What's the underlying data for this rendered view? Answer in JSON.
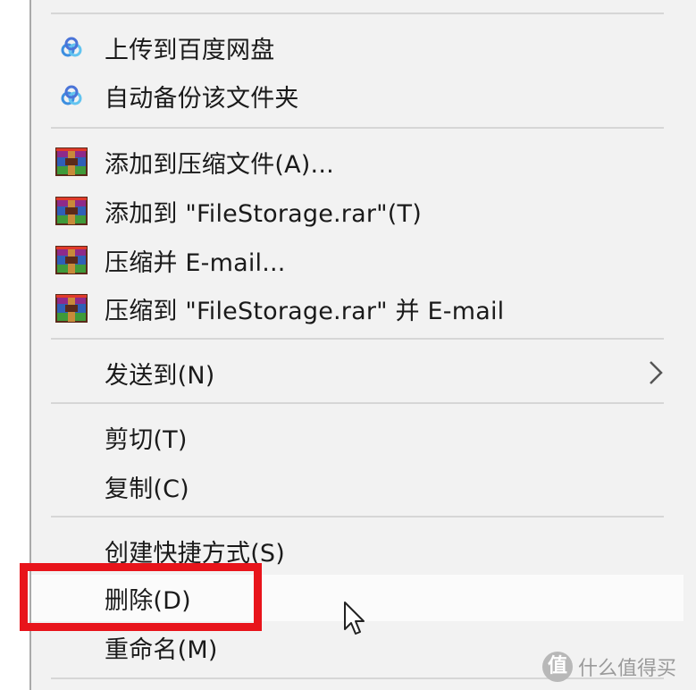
{
  "menu": {
    "baidu_group": [
      {
        "label": "上传到百度网盘",
        "icon": "baidu-netdisk-icon"
      },
      {
        "label": "自动备份该文件夹",
        "icon": "baidu-netdisk-icon"
      }
    ],
    "winrar_group": [
      {
        "label": "添加到压缩文件(A)...",
        "icon": "winrar-icon"
      },
      {
        "label": "添加到 \"FileStorage.rar\"(T)",
        "icon": "winrar-icon"
      },
      {
        "label": "压缩并 E-mail...",
        "icon": "winrar-icon"
      },
      {
        "label": "压缩到 \"FileStorage.rar\" 并 E-mail",
        "icon": "winrar-icon"
      }
    ],
    "send_to": {
      "label": "发送到(N)",
      "icon": "chevron-right-icon"
    },
    "clipboard_group": [
      {
        "label": "剪切(T)"
      },
      {
        "label": "复制(C)"
      }
    ],
    "file_group": [
      {
        "label": "创建快捷方式(S)"
      },
      {
        "label": "删除(D)"
      },
      {
        "label": "重命名(M)"
      }
    ]
  },
  "watermark": {
    "logo": "值",
    "text": "什么值得买"
  },
  "colors": {
    "menu_bg": "#f2f2f2",
    "hover_bg": "#fbfbfb",
    "separator": "#d6d6d6",
    "annotation_red": "#e8141b"
  }
}
